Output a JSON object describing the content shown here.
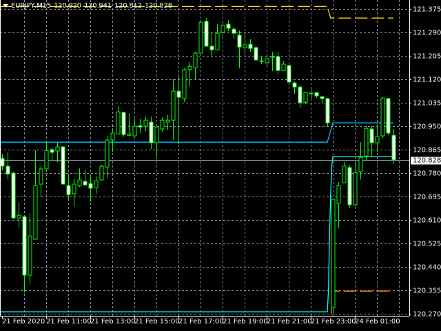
{
  "header": {
    "symbol": "EURJPY,M15",
    "open": "120.920",
    "high": "120.941",
    "low": "120.812",
    "close": "120.828"
  },
  "colors": {
    "bg": "#000000",
    "grid": "#8A8F99",
    "candle": "#00FF00",
    "bear_body": "#FFFFFF",
    "bull_body": "#000000",
    "close_line": "#8899AA",
    "blue_line": "#00BFFF",
    "cyan_line": "#00FFFF",
    "gold_line": "#FFD700",
    "orange_line": "#FF8C00"
  },
  "chart_data": {
    "type": "candlestick",
    "title": "EURJPY,M15",
    "ylim": [
      120.27,
      121.375
    ],
    "price_ticks": [
      "121.375",
      "121.290",
      "121.205",
      "121.120",
      "121.035",
      "120.950",
      "120.865",
      "120.780",
      "120.695",
      "120.610",
      "120.525",
      "120.440",
      "120.355",
      "120.270"
    ],
    "current_price": "120.828",
    "time_ticks": [
      {
        "label": "21 Feb 2020",
        "bar": 0
      },
      {
        "label": "21 Feb 11:00",
        "bar": 8
      },
      {
        "label": "21 Feb 13:00",
        "bar": 16
      },
      {
        "label": "21 Feb 15:00",
        "bar": 24
      },
      {
        "label": "21 Feb 17:00",
        "bar": 32
      },
      {
        "label": "21 Feb 19:00",
        "bar": 40
      },
      {
        "label": "21 Feb 21:00",
        "bar": 48
      },
      {
        "label": "21 Feb 23:00",
        "bar": 56
      },
      {
        "label": "24 Feb 01:00",
        "bar": 64
      }
    ],
    "ohlc": [
      [
        120.833,
        120.85,
        120.79,
        120.805
      ],
      [
        120.805,
        120.855,
        120.757,
        120.777
      ],
      [
        120.78,
        120.785,
        120.615,
        120.617
      ],
      [
        120.617,
        120.672,
        120.582,
        120.627
      ],
      [
        120.622,
        120.622,
        120.347,
        120.41
      ],
      [
        120.41,
        120.632,
        120.38,
        120.552
      ],
      [
        120.54,
        120.862,
        120.54,
        120.735
      ],
      [
        120.74,
        120.807,
        120.692,
        120.795
      ],
      [
        120.795,
        120.895,
        120.795,
        120.862
      ],
      [
        120.865,
        120.875,
        120.825,
        120.855
      ],
      [
        120.86,
        120.89,
        120.82,
        120.875
      ],
      [
        120.875,
        120.88,
        120.74,
        120.74
      ],
      [
        120.735,
        120.775,
        120.687,
        120.702
      ],
      [
        120.705,
        120.76,
        120.657,
        120.74
      ],
      [
        120.735,
        120.797,
        120.73,
        120.755
      ],
      [
        120.75,
        120.79,
        120.735,
        120.737
      ],
      [
        120.742,
        120.772,
        120.675,
        120.725
      ],
      [
        120.727,
        120.767,
        120.705,
        120.752
      ],
      [
        120.755,
        120.81,
        120.755,
        120.805
      ],
      [
        120.802,
        120.915,
        120.762,
        120.9
      ],
      [
        120.9,
        120.937,
        120.857,
        120.925
      ],
      [
        120.922,
        121.022,
        120.922,
        121.002
      ],
      [
        121.0,
        121.0,
        120.912,
        120.92
      ],
      [
        120.917,
        120.997,
        120.915,
        120.922
      ],
      [
        120.915,
        120.977,
        120.915,
        120.95
      ],
      [
        120.952,
        120.977,
        120.925,
        120.947
      ],
      [
        120.95,
        120.985,
        120.932,
        120.972
      ],
      [
        120.965,
        120.985,
        120.867,
        120.89
      ],
      [
        120.89,
        120.947,
        120.84,
        120.947
      ],
      [
        120.94,
        120.982,
        120.93,
        120.972
      ],
      [
        120.965,
        120.99,
        120.935,
        120.972
      ],
      [
        120.972,
        121.122,
        120.9,
        121.077
      ],
      [
        121.077,
        121.132,
        120.885,
        121.055
      ],
      [
        121.05,
        121.16,
        121.037,
        121.155
      ],
      [
        121.155,
        121.182,
        121.095,
        121.167
      ],
      [
        121.162,
        121.22,
        121.117,
        121.215
      ],
      [
        121.215,
        121.335,
        121.215,
        121.327
      ],
      [
        121.33,
        121.342,
        121.24,
        121.24
      ],
      [
        121.24,
        121.29,
        121.2,
        121.227
      ],
      [
        121.227,
        121.32,
        121.225,
        121.287
      ],
      [
        121.29,
        121.325,
        121.277,
        121.315
      ],
      [
        121.32,
        121.335,
        121.295,
        121.305
      ],
      [
        121.302,
        121.31,
        121.267,
        121.287
      ],
      [
        121.28,
        121.297,
        121.16,
        121.237
      ],
      [
        121.235,
        121.28,
        121.215,
        121.245
      ],
      [
        121.247,
        121.265,
        121.22,
        121.232
      ],
      [
        121.235,
        121.245,
        121.19,
        121.19
      ],
      [
        121.187,
        121.205,
        121.175,
        121.185
      ],
      [
        121.18,
        121.207,
        121.167,
        121.195
      ],
      [
        121.202,
        121.22,
        121.15,
        121.2
      ],
      [
        121.202,
        121.22,
        121.14,
        121.152
      ],
      [
        121.152,
        121.185,
        121.152,
        121.175
      ],
      [
        121.17,
        121.177,
        121.097,
        121.11
      ],
      [
        121.107,
        121.112,
        121.067,
        121.092
      ],
      [
        121.092,
        121.1,
        121.015,
        121.035
      ],
      [
        121.037,
        121.072,
        121.03,
        121.072
      ],
      [
        121.07,
        121.087,
        121.05,
        121.07
      ],
      [
        121.072,
        121.072,
        121.052,
        121.06
      ],
      [
        121.057,
        121.06,
        121.035,
        121.05
      ],
      [
        121.05,
        121.052,
        120.95,
        120.962
      ],
      [
        120.292,
        120.685,
        120.27,
        120.685
      ],
      [
        120.67,
        120.747,
        120.58,
        120.735
      ],
      [
        120.745,
        120.82,
        120.745,
        120.805
      ],
      [
        120.8,
        120.81,
        120.652,
        120.665
      ],
      [
        120.665,
        120.82,
        120.66,
        120.782
      ],
      [
        120.785,
        120.892,
        120.757,
        120.837
      ],
      [
        120.842,
        120.95,
        120.825,
        120.942
      ],
      [
        120.94,
        120.95,
        120.837,
        120.89
      ],
      [
        120.89,
        120.952,
        120.855,
        120.912
      ],
      [
        120.915,
        121.057,
        120.907,
        121.052
      ],
      [
        121.05,
        121.052,
        120.917,
        120.925
      ],
      [
        120.917,
        120.94,
        120.812,
        120.828
      ]
    ],
    "indicators": [
      {
        "name": "blue-level-line",
        "color": "#00BFFF",
        "dashed": false,
        "points": [
          [
            -0.5,
            120.892
          ],
          [
            59,
            120.892
          ],
          [
            60,
            120.962
          ],
          [
            71,
            120.962
          ]
        ]
      },
      {
        "name": "cyan-level-line",
        "color": "#00FFFF",
        "dashed": false,
        "points": [
          [
            -0.5,
            120.277
          ],
          [
            59,
            120.277
          ],
          [
            59.2,
            120.35
          ],
          [
            59.4,
            120.55
          ],
          [
            59.6,
            120.7
          ],
          [
            59.8,
            120.8
          ],
          [
            60,
            120.84
          ],
          [
            71,
            120.84
          ]
        ]
      },
      {
        "name": "gold-dashed-line",
        "color": "#FFD700",
        "dashed": true,
        "points": [
          [
            -0.5,
            121.384
          ],
          [
            59,
            121.384
          ],
          [
            59.6,
            121.342
          ],
          [
            71,
            121.342
          ]
        ]
      },
      {
        "name": "orange-dashed-line",
        "color": "#FF8C00",
        "dashed": true,
        "points": [
          [
            59.7,
            120.27
          ],
          [
            59.9,
            120.34
          ],
          [
            60.1,
            120.352
          ],
          [
            71,
            120.352
          ]
        ]
      }
    ]
  }
}
